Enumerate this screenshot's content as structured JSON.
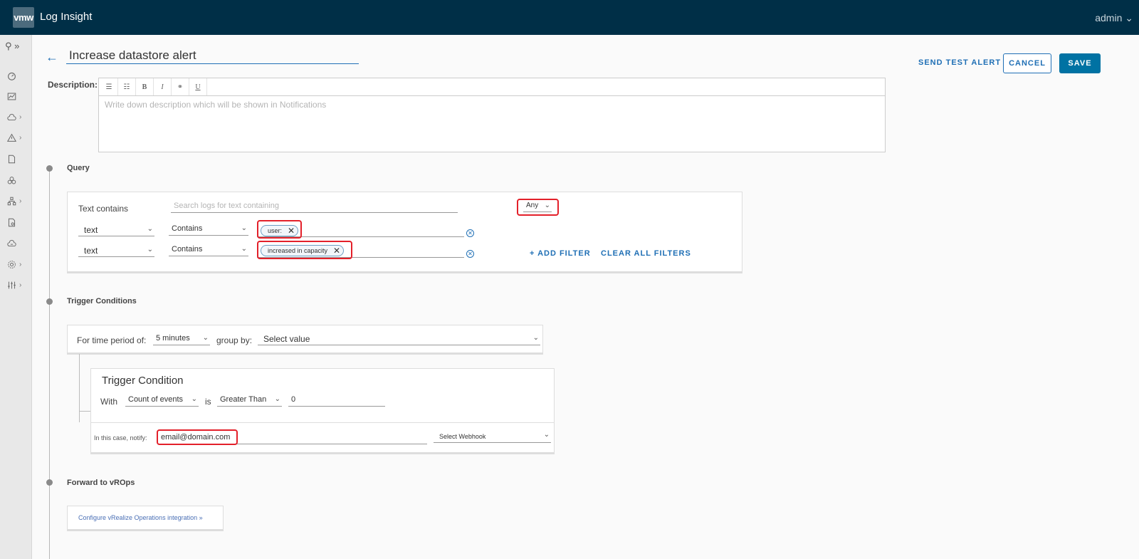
{
  "header": {
    "logo_text": "vmw",
    "app_title": "Log Insight",
    "user": "admin"
  },
  "sidenav": {
    "toggle": "⚲ »",
    "items": [
      {
        "name": "dashboard-icon",
        "caret": ""
      },
      {
        "name": "chart-icon",
        "caret": ""
      },
      {
        "name": "cloud-icon",
        "caret": "›"
      },
      {
        "name": "alert-icon",
        "caret": "›"
      },
      {
        "name": "document-icon",
        "caret": ""
      },
      {
        "name": "cluster-icon",
        "caret": ""
      },
      {
        "name": "network-icon",
        "caret": "›"
      },
      {
        "name": "file-settings-icon",
        "caret": ""
      },
      {
        "name": "cloud-settings-icon",
        "caret": ""
      },
      {
        "name": "gear-icon",
        "caret": "›"
      },
      {
        "name": "sliders-icon",
        "caret": "›"
      }
    ]
  },
  "alert": {
    "title": "Increase datastore alert",
    "send_test": "SEND TEST ALERT",
    "cancel": "CANCEL",
    "save": "SAVE"
  },
  "description": {
    "label": "Description:",
    "placeholder": "Write down description which will be shown in Notifications",
    "toolbar": [
      "☰",
      "☷",
      "B",
      "I",
      "⚭",
      "U"
    ]
  },
  "query": {
    "title": "Query",
    "text_contains_label": "Text contains",
    "search_placeholder": "Search logs for text containing",
    "any_label": "Any",
    "filters": [
      {
        "field": "text",
        "operator": "Contains",
        "chip": "user:"
      },
      {
        "field": "text",
        "operator": "Contains",
        "chip": "increased in capacity"
      }
    ],
    "add_filter": "+ ADD FILTER",
    "clear_filters": "CLEAR ALL FILTERS"
  },
  "trigger": {
    "title": "Trigger Conditions",
    "time_period_label": "For time period of:",
    "time_period_value": "5 minutes",
    "group_by_label": "group by:",
    "group_by_value": "Select value",
    "condition_title": "Trigger Condition",
    "with_label": "With",
    "count_value": "Count of events",
    "is_label": "is",
    "comparison_value": "Greater Than",
    "threshold_value": "0",
    "notify_label": "In this case, notify:",
    "email_value": "email@domain.com",
    "webhook_value": "Select Webhook"
  },
  "vrops": {
    "title": "Forward to vROps",
    "link": "Configure vRealize Operations integration »"
  },
  "colors": {
    "header_bg": "#002f47",
    "accent": "#0072a3",
    "highlight": "#e3202a"
  }
}
